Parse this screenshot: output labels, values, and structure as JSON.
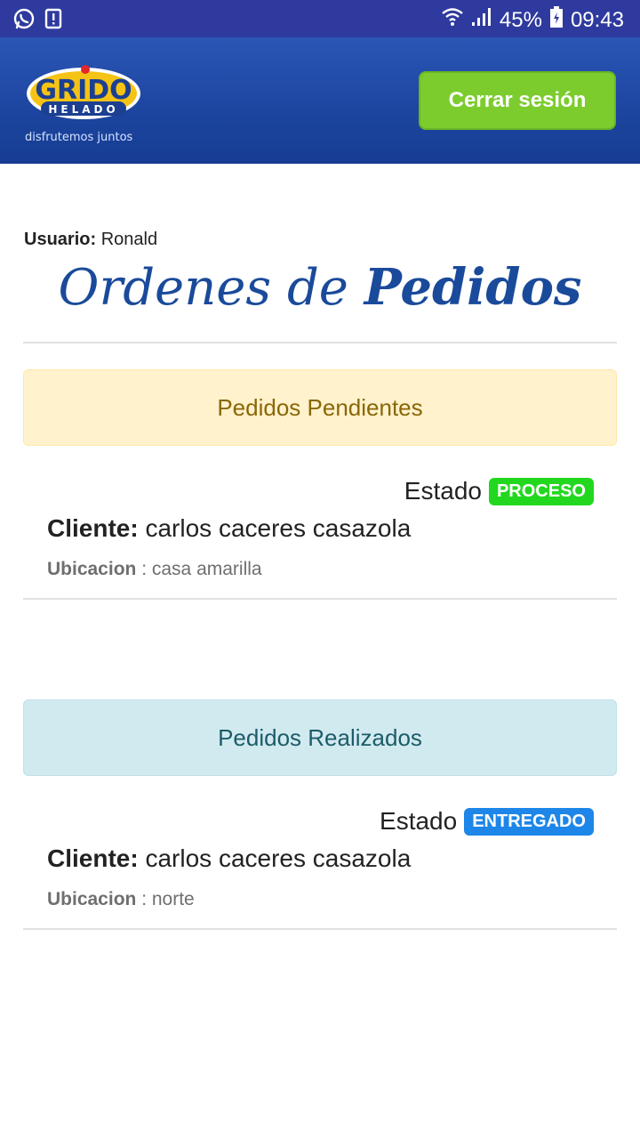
{
  "status_bar": {
    "battery": "45%",
    "time": "09:43",
    "icons": [
      "whatsapp-icon",
      "alert-icon",
      "wifi-icon",
      "signal-icon",
      "battery-icon"
    ]
  },
  "header": {
    "logo_text": "GRIDO",
    "logo_subtext": "HELADO",
    "logo_tagline": "disfrutemos juntos",
    "logout_label": "Cerrar sesión"
  },
  "user": {
    "label": "Usuario:",
    "name": "Ronald"
  },
  "page_title": {
    "part1": "Ordenes de",
    "part2": "Pedidos"
  },
  "sections": [
    {
      "title": "Pedidos Pendientes",
      "orders": [
        {
          "estado_label": "Estado",
          "estado_value": "PROCESO",
          "cliente_label": "Cliente:",
          "cliente_value": "carlos caceres casazola",
          "ubicacion_label": "Ubicacion",
          "ubicacion_value": ": casa amarilla"
        }
      ]
    },
    {
      "title": "Pedidos Realizados",
      "orders": [
        {
          "estado_label": "Estado",
          "estado_value": "ENTREGADO",
          "cliente_label": "Cliente:",
          "cliente_value": "carlos caceres casazola",
          "ubicacion_label": "Ubicacion",
          "ubicacion_value": ": norte"
        }
      ]
    }
  ],
  "colors": {
    "status_bar": "#2f3a9e",
    "header": "#1c459f",
    "logout_button": "#7ccc2e",
    "title": "#1a4a9a",
    "badge_proceso": "#22d81e",
    "badge_entregado": "#1d86e8"
  }
}
